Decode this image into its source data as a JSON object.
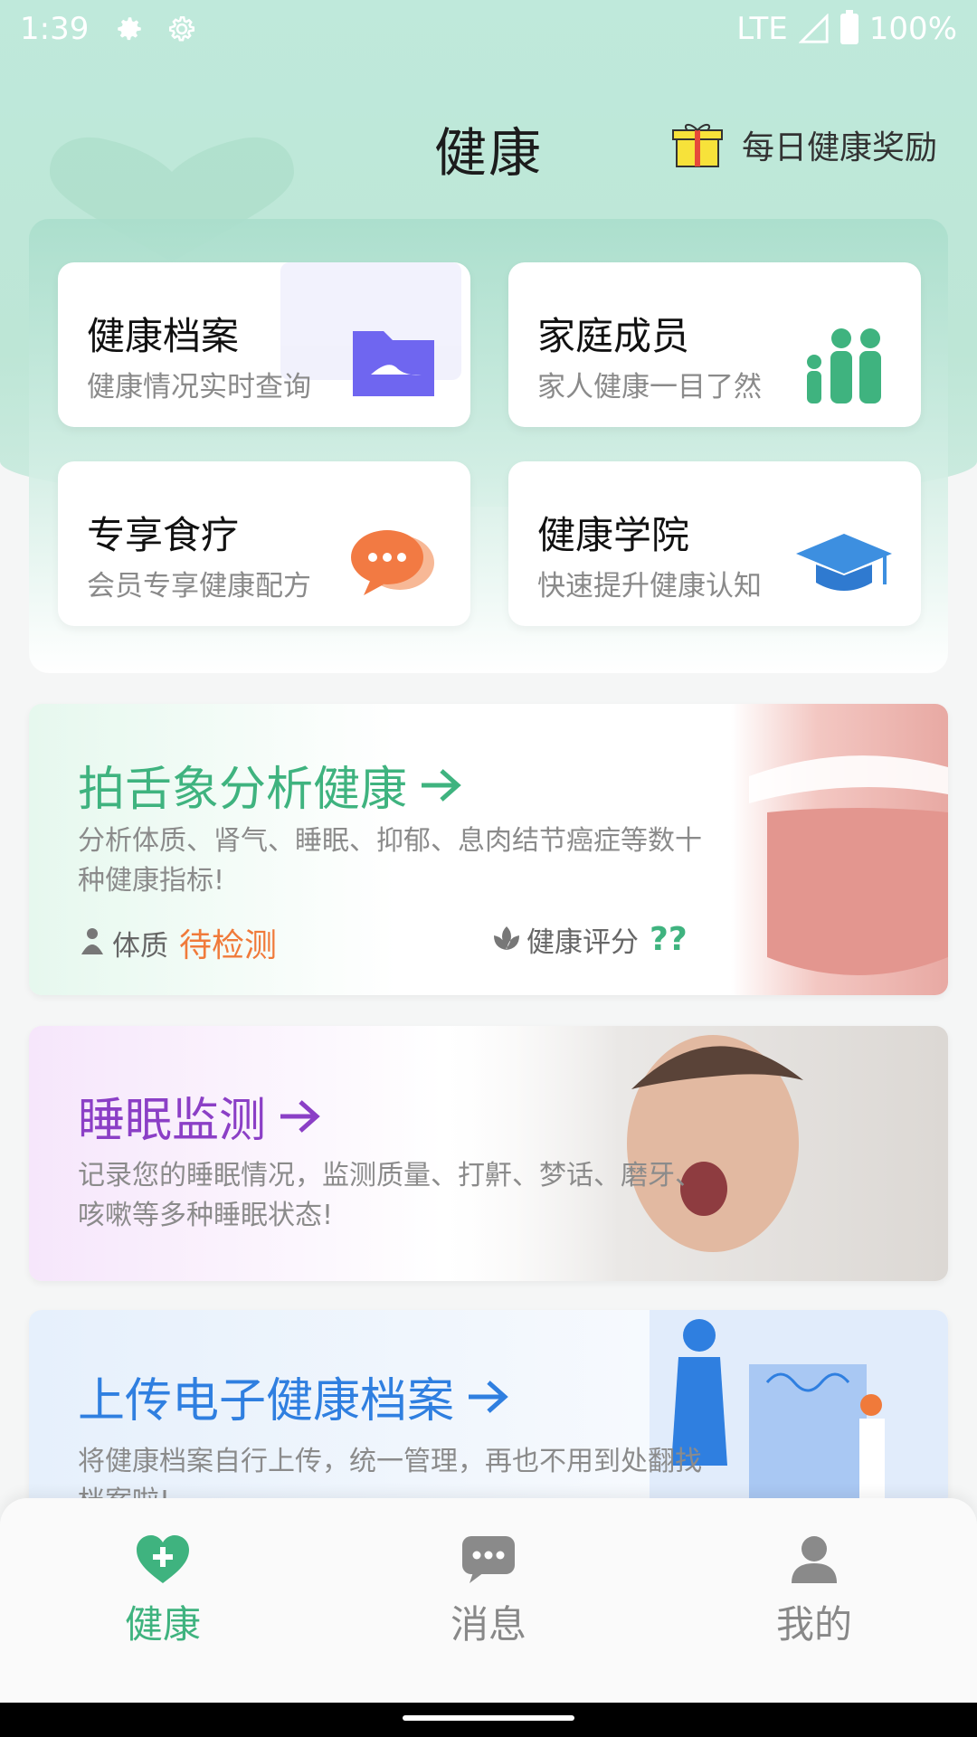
{
  "status_bar": {
    "time": "1:39",
    "network": "LTE",
    "battery": "100%"
  },
  "header": {
    "title": "健康",
    "reward_label": "每日健康奖励"
  },
  "tiles": [
    {
      "title": "健康档案",
      "subtitle": "健康情况实时查询",
      "icon": "folder-icon"
    },
    {
      "title": "家庭成员",
      "subtitle": "家人健康一目了然",
      "icon": "family-icon"
    },
    {
      "title": "专享食疗",
      "subtitle": "会员专享健康配方",
      "icon": "chat-bubble-icon"
    },
    {
      "title": "健康学院",
      "subtitle": "快速提升健康认知",
      "icon": "graduation-cap-icon"
    }
  ],
  "tongue_card": {
    "title": "拍舌象分析健康",
    "description": "分析体质、肾气、睡眠、抑郁、息肉结节癌症等数十种健康指标!",
    "constitution_label": "体质",
    "constitution_value": "待检测",
    "score_label": "健康评分",
    "score_value": "??"
  },
  "sleep_card": {
    "title": "睡眠监测",
    "description": "记录您的睡眠情况，监测质量、打鼾、梦话、磨牙、咳嗽等多种睡眠状态!"
  },
  "upload_card": {
    "title": "上传电子健康档案",
    "description": "将健康档案自行上传，统一管理，再也不用到处翻找档案啦!"
  },
  "bottom_nav": [
    {
      "label": "健康",
      "icon": "heart-plus-icon",
      "active": true
    },
    {
      "label": "消息",
      "icon": "message-icon",
      "active": false
    },
    {
      "label": "我的",
      "icon": "user-icon",
      "active": false
    }
  ],
  "colors": {
    "brand_green": "#3fb37f",
    "purple": "#8b3fc6",
    "blue": "#2f7fe0",
    "orange": "#f07a3a",
    "inactive": "#888888"
  }
}
